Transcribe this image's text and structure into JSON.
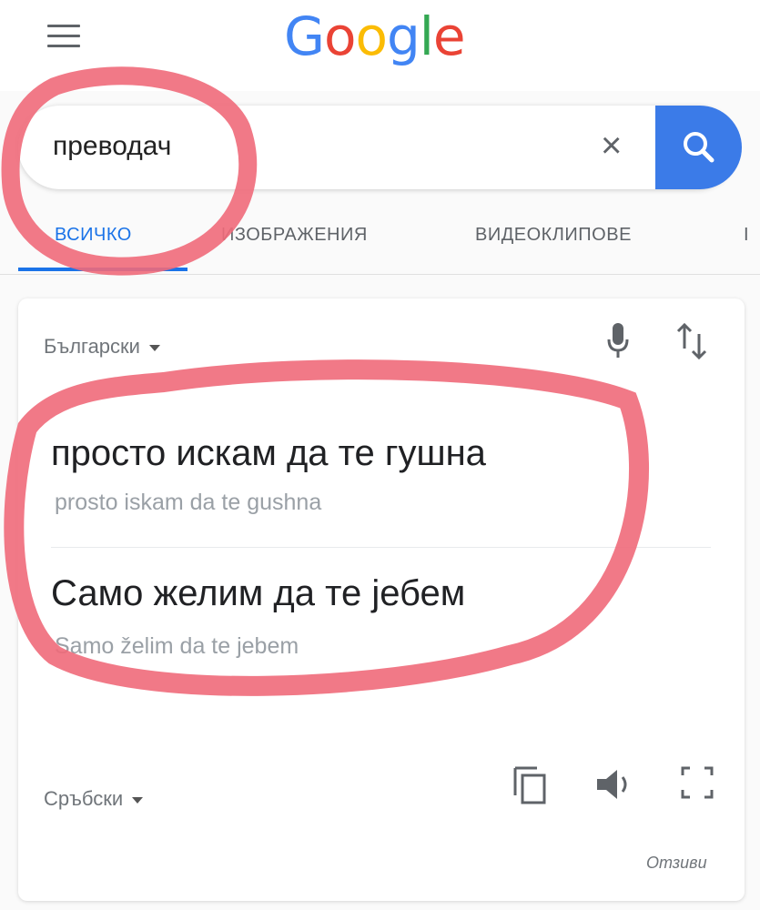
{
  "header": {
    "logo_letters": [
      "G",
      "o",
      "o",
      "g",
      "l",
      "e"
    ],
    "menu_icon": "hamburger-menu-icon"
  },
  "search": {
    "query": "преводач",
    "clear_icon": "×",
    "search_icon": "search-icon"
  },
  "tabs": [
    {
      "label": "ВСИЧКО",
      "active": true
    },
    {
      "label": "ИЗОБРАЖЕНИЯ",
      "active": false
    },
    {
      "label": "ВИДЕОКЛИПОВЕ",
      "active": false
    },
    {
      "label": "І",
      "active": false
    }
  ],
  "translator": {
    "source_language": "Български",
    "target_language": "Сръбски",
    "source_text": "просто искам да те гушна",
    "source_transliteration": "prosto iskam da te gushna",
    "target_text": "Само желим да те јебем",
    "target_transliteration": "Samo želim da te jebem",
    "feedback_label": "Отзиви",
    "icons": [
      "mic-icon",
      "swap-icon",
      "copy-icon",
      "speaker-icon",
      "expand-icon"
    ]
  },
  "colors": {
    "accent": "#1a73e8",
    "search_button": "#3b7be8",
    "annotation": "#f06a7a"
  }
}
